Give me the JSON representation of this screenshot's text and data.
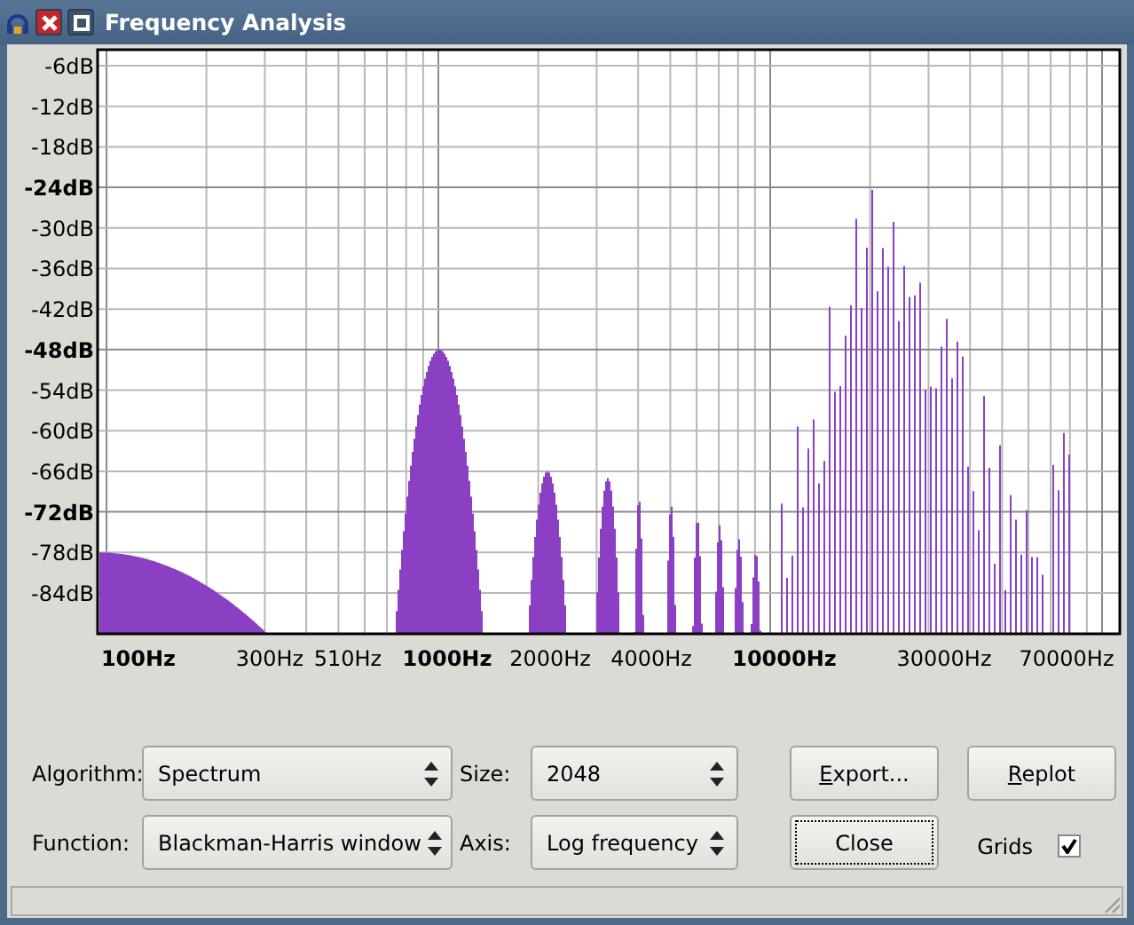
{
  "window": {
    "title": "Frequency Analysis"
  },
  "graph": {
    "y_axis_labels": [
      {
        "text": "-6dB",
        "bold": false
      },
      {
        "text": "-12dB",
        "bold": false
      },
      {
        "text": "-18dB",
        "bold": false
      },
      {
        "text": "-24dB",
        "bold": true
      },
      {
        "text": "-30dB",
        "bold": false
      },
      {
        "text": "-36dB",
        "bold": false
      },
      {
        "text": "-42dB",
        "bold": false
      },
      {
        "text": "-48dB",
        "bold": true
      },
      {
        "text": "-54dB",
        "bold": false
      },
      {
        "text": "-60dB",
        "bold": false
      },
      {
        "text": "-66dB",
        "bold": false
      },
      {
        "text": "-72dB",
        "bold": true
      },
      {
        "text": "-78dB",
        "bold": false
      },
      {
        "text": "-84dB",
        "bold": false
      }
    ],
    "x_axis_labels": [
      {
        "text": "100Hz",
        "bold": true
      },
      {
        "text": "300Hz",
        "bold": false
      },
      {
        "text": "510Hz",
        "bold": false
      },
      {
        "text": "1000Hz",
        "bold": true
      },
      {
        "text": "2000Hz",
        "bold": false
      },
      {
        "text": "4000Hz",
        "bold": false
      },
      {
        "text": "10000Hz",
        "bold": true
      },
      {
        "text": "30000Hz",
        "bold": false
      },
      {
        "text": "70000Hz",
        "bold": false
      }
    ]
  },
  "fields": [
    {
      "label": "Algorithm:",
      "value": "Spectrum"
    },
    {
      "label": "Size:",
      "value": "2048"
    },
    {
      "label": "Function:",
      "value": "Blackman-Harris window"
    },
    {
      "label": "Axis:",
      "value": "Log frequency"
    }
  ],
  "buttons": [
    {
      "label": "Export...",
      "mnemonic": true,
      "focused": false
    },
    {
      "label": "Replot",
      "mnemonic": true,
      "focused": false
    },
    {
      "label": "Close",
      "mnemonic": false,
      "focused": true
    }
  ],
  "grids": {
    "label": "Grids",
    "checked": true
  }
}
